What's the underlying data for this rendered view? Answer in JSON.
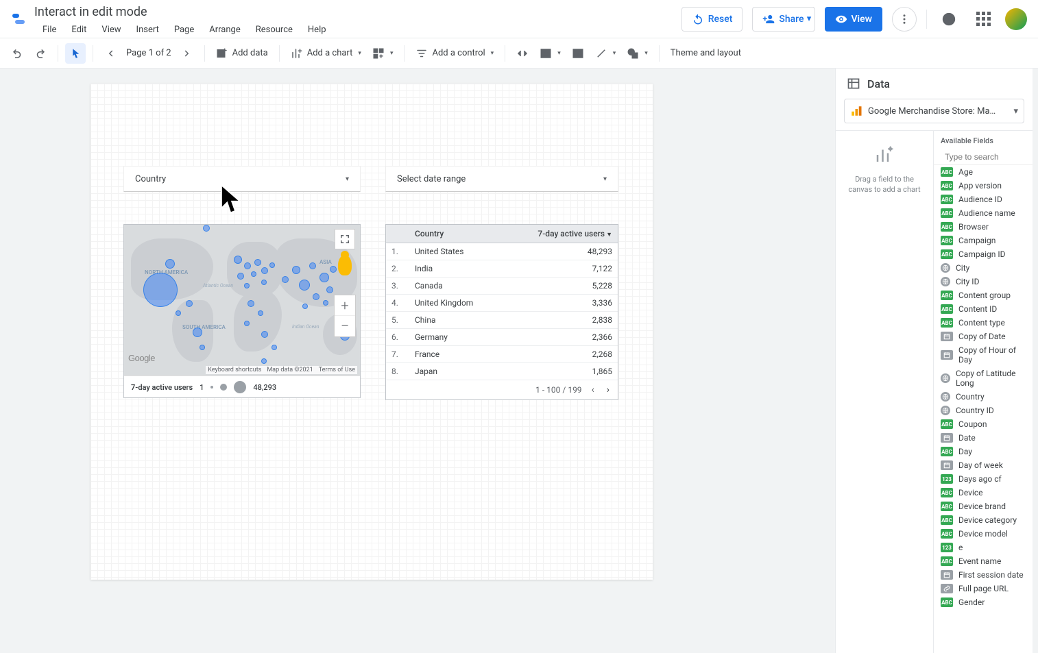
{
  "header": {
    "title": "Interact in edit mode",
    "reset": "Reset",
    "share": "Share",
    "view": "View"
  },
  "menubar": [
    "File",
    "Edit",
    "View",
    "Insert",
    "Page",
    "Arrange",
    "Resource",
    "Help"
  ],
  "toolbar": {
    "page_label": "Page 1 of 2",
    "add_data": "Add data",
    "add_chart": "Add a chart",
    "add_control": "Add a control",
    "theme": "Theme and layout"
  },
  "canvas": {
    "country_filter": {
      "label": "Country"
    },
    "date_filter": {
      "label": "Select date range"
    },
    "map": {
      "legend_metric": "7-day active users",
      "legend_min": "1",
      "legend_max": "48,293",
      "google": "Google",
      "kb_shortcuts": "Keyboard shortcuts",
      "map_data": "Map data ©2021",
      "terms": "Terms of Use",
      "continents": {
        "na": "NORTH AMERICA",
        "sa": "SOUTH AMERICA",
        "asia": "ASIA",
        "atlantic": "Atlantic Ocean",
        "indian": "Indian Ocean"
      }
    },
    "table": {
      "col_index": "",
      "col_country": "Country",
      "col_metric": "7-day active users",
      "rows": [
        {
          "i": "1.",
          "c": "United States",
          "v": "48,293"
        },
        {
          "i": "2.",
          "c": "India",
          "v": "7,122"
        },
        {
          "i": "3.",
          "c": "Canada",
          "v": "5,228"
        },
        {
          "i": "4.",
          "c": "United Kingdom",
          "v": "3,336"
        },
        {
          "i": "5.",
          "c": "China",
          "v": "2,838"
        },
        {
          "i": "6.",
          "c": "Germany",
          "v": "2,366"
        },
        {
          "i": "7.",
          "c": "France",
          "v": "2,268"
        },
        {
          "i": "8.",
          "c": "Japan",
          "v": "1,865"
        }
      ],
      "pager": "1 - 100 / 199"
    }
  },
  "panel": {
    "title": "Data",
    "data_source": "Google Merchandise Store: Ma…",
    "drop_hint": "Drag a field to the canvas to add a chart",
    "fields_header": "Available Fields",
    "search_placeholder": "Type to search",
    "fields": [
      {
        "t": "abc",
        "n": "Age"
      },
      {
        "t": "abc",
        "n": "App version"
      },
      {
        "t": "abc",
        "n": "Audience ID"
      },
      {
        "t": "abc",
        "n": "Audience name"
      },
      {
        "t": "abc",
        "n": "Browser"
      },
      {
        "t": "abc",
        "n": "Campaign"
      },
      {
        "t": "abc",
        "n": "Campaign ID"
      },
      {
        "t": "geo",
        "n": "City"
      },
      {
        "t": "geo",
        "n": "City ID"
      },
      {
        "t": "abc",
        "n": "Content group"
      },
      {
        "t": "abc",
        "n": "Content ID"
      },
      {
        "t": "abc",
        "n": "Content type"
      },
      {
        "t": "date",
        "n": "Copy of Date"
      },
      {
        "t": "date",
        "n": "Copy of Hour of Day"
      },
      {
        "t": "geo",
        "n": "Copy of Latitude Long"
      },
      {
        "t": "geo",
        "n": "Country"
      },
      {
        "t": "geo",
        "n": "Country ID"
      },
      {
        "t": "abc",
        "n": "Coupon"
      },
      {
        "t": "date",
        "n": "Date"
      },
      {
        "t": "abc",
        "n": "Day"
      },
      {
        "t": "date",
        "n": "Day of week"
      },
      {
        "t": "123",
        "n": "Days ago cf"
      },
      {
        "t": "abc",
        "n": "Device"
      },
      {
        "t": "abc",
        "n": "Device brand"
      },
      {
        "t": "abc",
        "n": "Device category"
      },
      {
        "t": "abc",
        "n": "Device model"
      },
      {
        "t": "123",
        "n": "e"
      },
      {
        "t": "abc",
        "n": "Event name"
      },
      {
        "t": "date",
        "n": "First session date"
      },
      {
        "t": "link",
        "n": "Full page URL"
      },
      {
        "t": "abc",
        "n": "Gender"
      }
    ]
  },
  "chart_data": {
    "type": "table",
    "title": "7-day active users by Country",
    "columns": [
      "Country",
      "7-day active users"
    ],
    "rows": [
      [
        "United States",
        48293
      ],
      [
        "India",
        7122
      ],
      [
        "Canada",
        5228
      ],
      [
        "United Kingdom",
        3336
      ],
      [
        "China",
        2838
      ],
      [
        "Germany",
        2366
      ],
      [
        "France",
        2268
      ],
      [
        "Japan",
        1865
      ]
    ],
    "total_rows": 199,
    "page": "1-100"
  }
}
